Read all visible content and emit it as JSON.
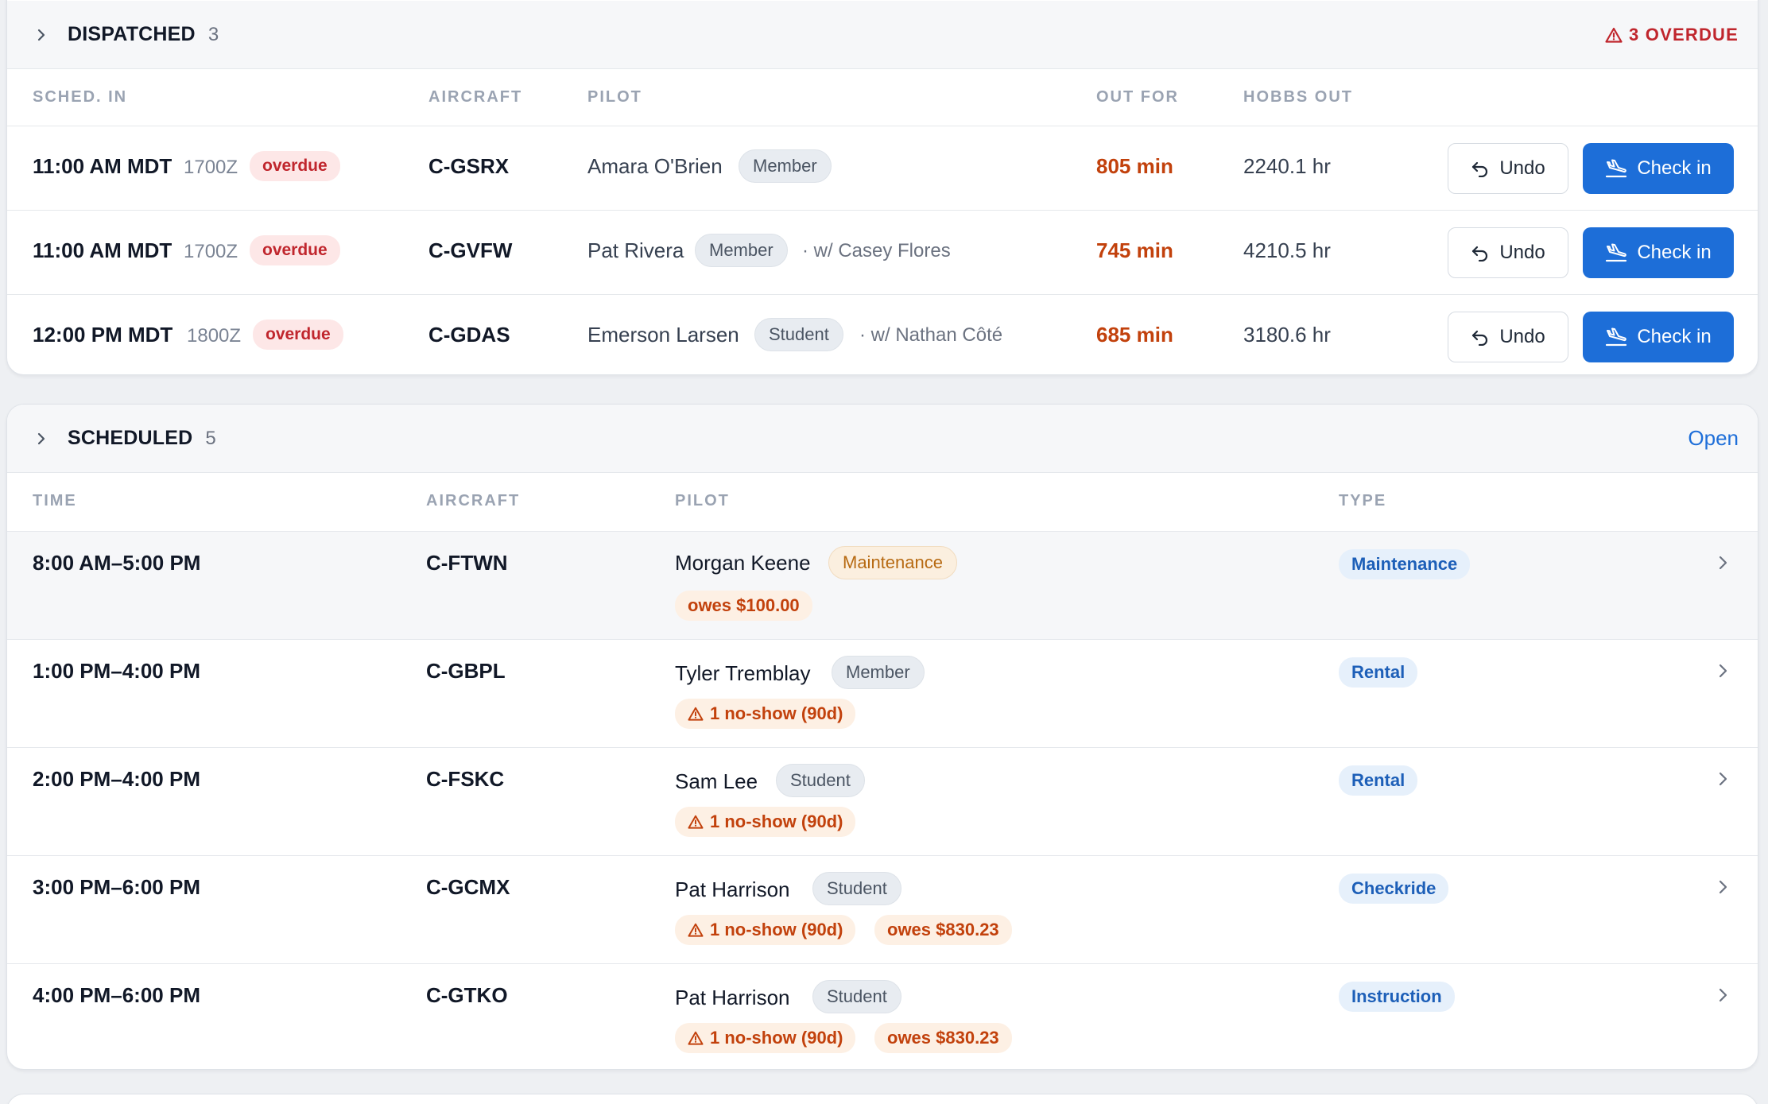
{
  "colors": {
    "accent": "#1d6ed8",
    "overdue_red": "#c0262d",
    "warning_orange": "#c2410c",
    "maintenance_amber": "#b76a12",
    "type_chip_blue": "#1d5fb8"
  },
  "dispatched": {
    "title": "DISPATCHED",
    "count": "3",
    "overdue_label": "3 OVERDUE",
    "columns": {
      "sched_in": "SCHED. IN",
      "aircraft": "AIRCRAFT",
      "pilot": "PILOT",
      "out_for": "OUT FOR",
      "hobbs_out": "HOBBS OUT"
    },
    "rows": [
      {
        "time": "11:00 AM MDT",
        "zulu": "1700Z",
        "status": "overdue",
        "aircraft": "C-GSRX",
        "pilot": "Amara O'Brien",
        "role": "Member",
        "with": "",
        "out_for": "805 min",
        "hobbs": "2240.1 hr",
        "undo_label": "Undo",
        "checkin_label": "Check in"
      },
      {
        "time": "11:00 AM MDT",
        "zulu": "1700Z",
        "status": "overdue",
        "aircraft": "C-GVFW",
        "pilot": "Pat Rivera",
        "role": "Member",
        "with": "· w/ Casey Flores",
        "out_for": "745 min",
        "hobbs": "4210.5 hr",
        "undo_label": "Undo",
        "checkin_label": "Check in"
      },
      {
        "time": "12:00 PM MDT",
        "zulu": "1800Z",
        "status": "overdue",
        "aircraft": "C-GDAS",
        "pilot": "Emerson Larsen",
        "role": "Student",
        "with": "· w/ Nathan Côté",
        "out_for": "685 min",
        "hobbs": "3180.6 hr",
        "undo_label": "Undo",
        "checkin_label": "Check in"
      }
    ]
  },
  "scheduled": {
    "title": "SCHEDULED",
    "count": "5",
    "open_label": "Open",
    "columns": {
      "time": "TIME",
      "aircraft": "AIRCRAFT",
      "pilot": "PILOT",
      "type": "TYPE"
    },
    "rows": [
      {
        "time": "8:00 AM–5:00 PM",
        "aircraft": "C-FTWN",
        "pilot": "Morgan Keene",
        "role": "Maintenance",
        "noshow": "",
        "owes": "owes $100.00",
        "type": "Maintenance"
      },
      {
        "time": "1:00 PM–4:00 PM",
        "aircraft": "C-GBPL",
        "pilot": "Tyler Tremblay",
        "role": "Member",
        "noshow": "1 no-show (90d)",
        "owes": "",
        "type": "Rental"
      },
      {
        "time": "2:00 PM–4:00 PM",
        "aircraft": "C-FSKC",
        "pilot": "Sam Lee",
        "role": "Student",
        "noshow": "1 no-show (90d)",
        "owes": "",
        "type": "Rental"
      },
      {
        "time": "3:00 PM–6:00 PM",
        "aircraft": "C-GCMX",
        "pilot": "Pat Harrison",
        "role": "Student",
        "noshow": "1 no-show (90d)",
        "owes": "owes $830.23",
        "type": "Checkride"
      },
      {
        "time": "4:00 PM–6:00 PM",
        "aircraft": "C-GTKO",
        "pilot": "Pat Harrison",
        "role": "Student",
        "noshow": "1 no-show (90d)",
        "owes": "owes $830.23",
        "type": "Instruction"
      }
    ]
  },
  "icons": {
    "collapse": "chevron-right-icon",
    "overdue": "warning-triangle-icon",
    "undo": "undo-arrow-icon",
    "checkin": "airplane-landing-icon",
    "row_open": "chevron-right-icon"
  }
}
